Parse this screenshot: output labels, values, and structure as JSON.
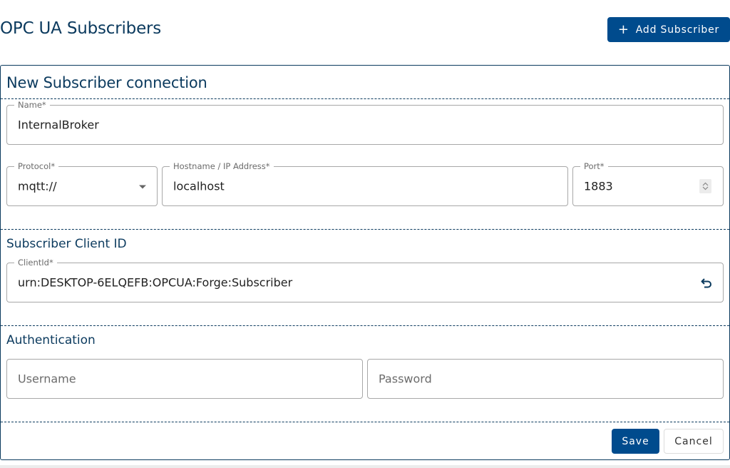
{
  "header": {
    "title": "OPC UA Subscribers",
    "add_button": {
      "icon": "plus-icon",
      "label": "Add Subscriber"
    }
  },
  "form": {
    "title": "New Subscriber connection",
    "name": {
      "label": "Name*",
      "value": "InternalBroker"
    },
    "protocol": {
      "label": "Protocol*",
      "value": "mqtt://"
    },
    "hostname": {
      "label": "Hostname / IP Address*",
      "value": "localhost"
    },
    "port": {
      "label": "Port*",
      "value": "1883"
    },
    "client_section": {
      "title": "Subscriber Client ID",
      "client_id": {
        "label": "ClientId*",
        "value": "urn:DESKTOP-6ELQEFB:OPCUA:Forge:Subscriber",
        "reset_icon": "undo-icon"
      }
    },
    "auth_section": {
      "title": "Authentication",
      "username": {
        "placeholder": "Username",
        "value": ""
      },
      "password": {
        "placeholder": "Password",
        "value": ""
      }
    },
    "actions": {
      "save": "Save",
      "cancel": "Cancel"
    }
  },
  "colors": {
    "primary": "#004b8d",
    "heading": "#0b3a5e",
    "border": "#a8a8a8"
  }
}
